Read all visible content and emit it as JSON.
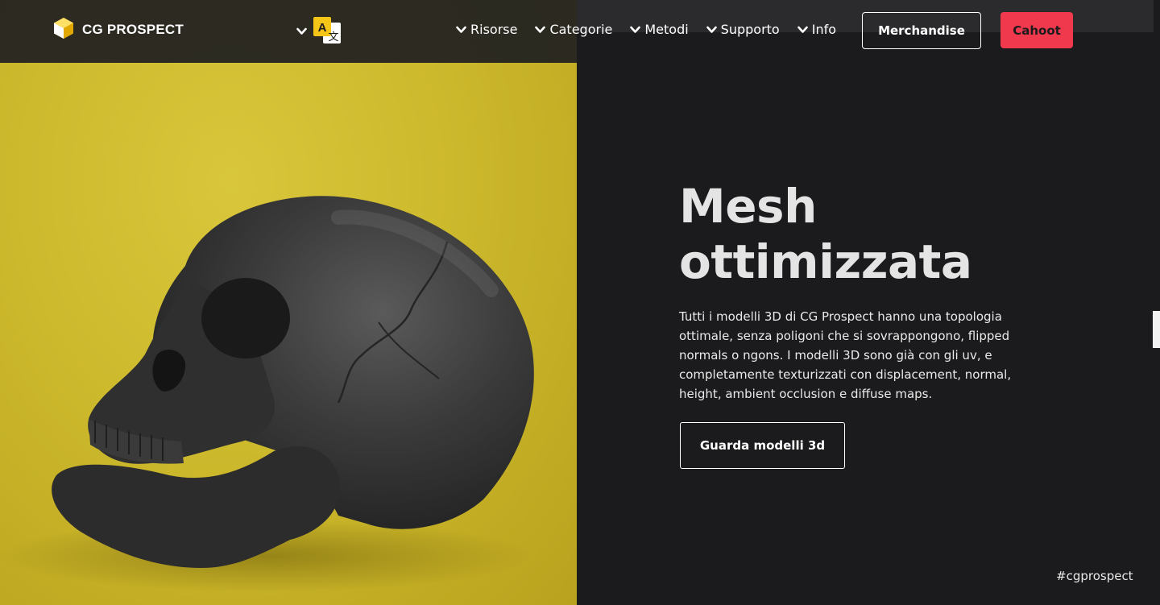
{
  "header": {
    "logo_text": "CG PROSPECT",
    "nav": [
      {
        "label": "Risorse"
      },
      {
        "label": "Categorie"
      },
      {
        "label": "Metodi"
      },
      {
        "label": "Supporto"
      },
      {
        "label": "Info"
      }
    ],
    "merch_label": "Merchandise",
    "cahoot_label": "Cahoot"
  },
  "hero": {
    "title_line1": "Mesh",
    "title_line2": "ottimizzata",
    "description": "Tutti i modelli 3D di CG Prospect hanno una topologia ottimale, senza poligoni che si sovrappongono, flipped normals o ngons. I modelli 3D sono già con gli uv, e completamente texturizzati con displacement, normal, height, ambient occlusion e diffuse maps.",
    "cta_label": "Guarda modelli 3d",
    "hashtag": "#cgprospect"
  },
  "colors": {
    "accent": "#f0394d",
    "background": "#1b1a1c",
    "image_background": "#cdb92c"
  },
  "icons": [
    "logo-cube-icon",
    "translate-icon",
    "chevron-down-icon",
    "skull-image"
  ]
}
